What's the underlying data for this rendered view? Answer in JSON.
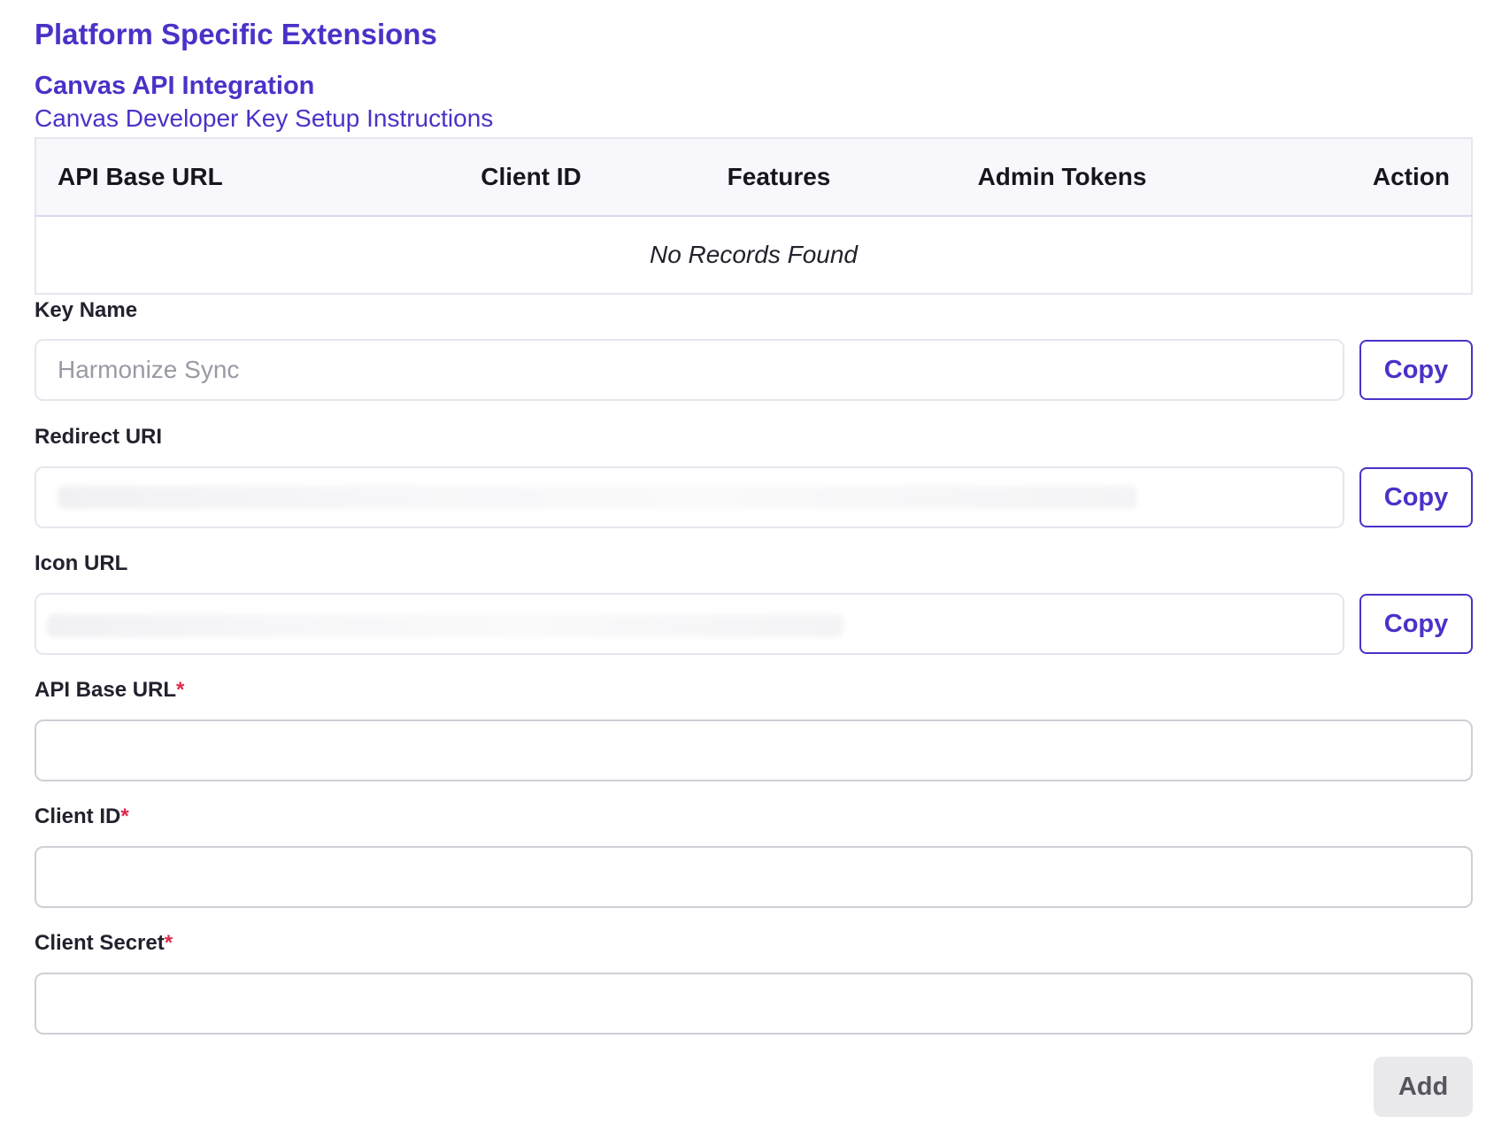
{
  "section_title": "Platform Specific Extensions",
  "integration": {
    "title": "Canvas API Integration",
    "setup_link": "Canvas Developer Key Setup Instructions"
  },
  "table": {
    "columns": [
      "API Base URL",
      "Client ID",
      "Features",
      "Admin Tokens",
      "Action"
    ],
    "empty_message": "No Records Found"
  },
  "fields": {
    "key_name": {
      "label": "Key Name",
      "placeholder": "Harmonize Sync",
      "copy_label": "Copy"
    },
    "redirect_uri": {
      "label": "Redirect URI",
      "copy_label": "Copy"
    },
    "icon_url": {
      "label": "Icon URL",
      "copy_label": "Copy"
    },
    "api_base_url": {
      "label": "API Base URL",
      "required_mark": "*"
    },
    "client_id": {
      "label": "Client ID",
      "required_mark": "*"
    },
    "client_secret": {
      "label": "Client Secret",
      "required_mark": "*"
    }
  },
  "actions": {
    "add_label": "Add"
  },
  "colors": {
    "accent": "#4a32c8",
    "required": "#e0284a",
    "table_header_bg": "#f7f7fc",
    "add_button_bg": "#e9e9ec"
  }
}
